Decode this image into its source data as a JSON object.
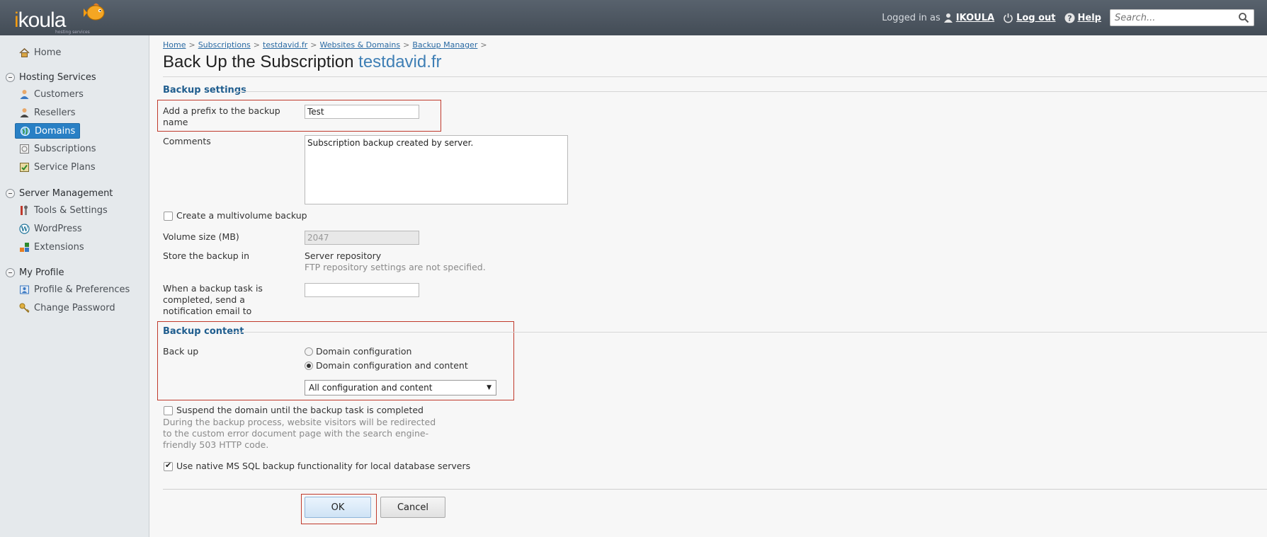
{
  "header": {
    "logo": "ikoula",
    "logo_tagline": "hosting services",
    "logged_in_prefix": "Logged in as",
    "username": "IKOULA",
    "logout": "Log out",
    "help": "Help",
    "search_placeholder": "Search..."
  },
  "sidebar": {
    "home": "Home",
    "sections": [
      {
        "title": "Hosting Services",
        "items": [
          "Customers",
          "Resellers",
          "Domains",
          "Subscriptions",
          "Service Plans"
        ]
      },
      {
        "title": "Server Management",
        "items": [
          "Tools & Settings",
          "WordPress",
          "Extensions"
        ]
      },
      {
        "title": "My Profile",
        "items": [
          "Profile & Preferences",
          "Change Password"
        ]
      }
    ],
    "active_item": "Domains"
  },
  "breadcrumb": [
    "Home",
    "Subscriptions",
    "testdavid.fr",
    "Websites & Domains",
    "Backup Manager"
  ],
  "page": {
    "title": "Back Up the Subscription",
    "subject": "testdavid.fr"
  },
  "backup_settings": {
    "section_title": "Backup settings",
    "prefix_label": "Add a prefix to the backup name",
    "prefix_value": "Test",
    "comments_label": "Comments",
    "comments_value": "Subscription backup created by server.",
    "multivolume_label": "Create a multivolume backup",
    "multivolume_checked": false,
    "volume_size_label": "Volume size (MB)",
    "volume_size_value": "2047",
    "store_label": "Store the backup in",
    "store_value": "Server repository",
    "store_hint": "FTP repository settings are not specified.",
    "notify_label": "When a backup task is completed, send a notification email to",
    "notify_value": ""
  },
  "backup_content": {
    "section_title": "Backup content",
    "backup_label": "Back up",
    "options": [
      "Domain configuration",
      "Domain configuration and content"
    ],
    "selected_option": "Domain configuration and content",
    "content_select": "All configuration and content",
    "suspend_label": "Suspend the domain until the backup task is completed",
    "suspend_checked": false,
    "suspend_hint": "During the backup process, website visitors will be redirected to the custom error document page with the search engine-friendly 503 HTTP code.",
    "mssql_label": "Use native MS SQL backup functionality for local database servers",
    "mssql_checked": true
  },
  "buttons": {
    "ok": "OK",
    "cancel": "Cancel"
  },
  "colors": {
    "header_bg": "#4b545e",
    "sidebar_bg": "#e5e9ec",
    "active_nav": "#2980c5",
    "section_title": "#1f5d8e",
    "highlight_box": "#c0392b"
  }
}
